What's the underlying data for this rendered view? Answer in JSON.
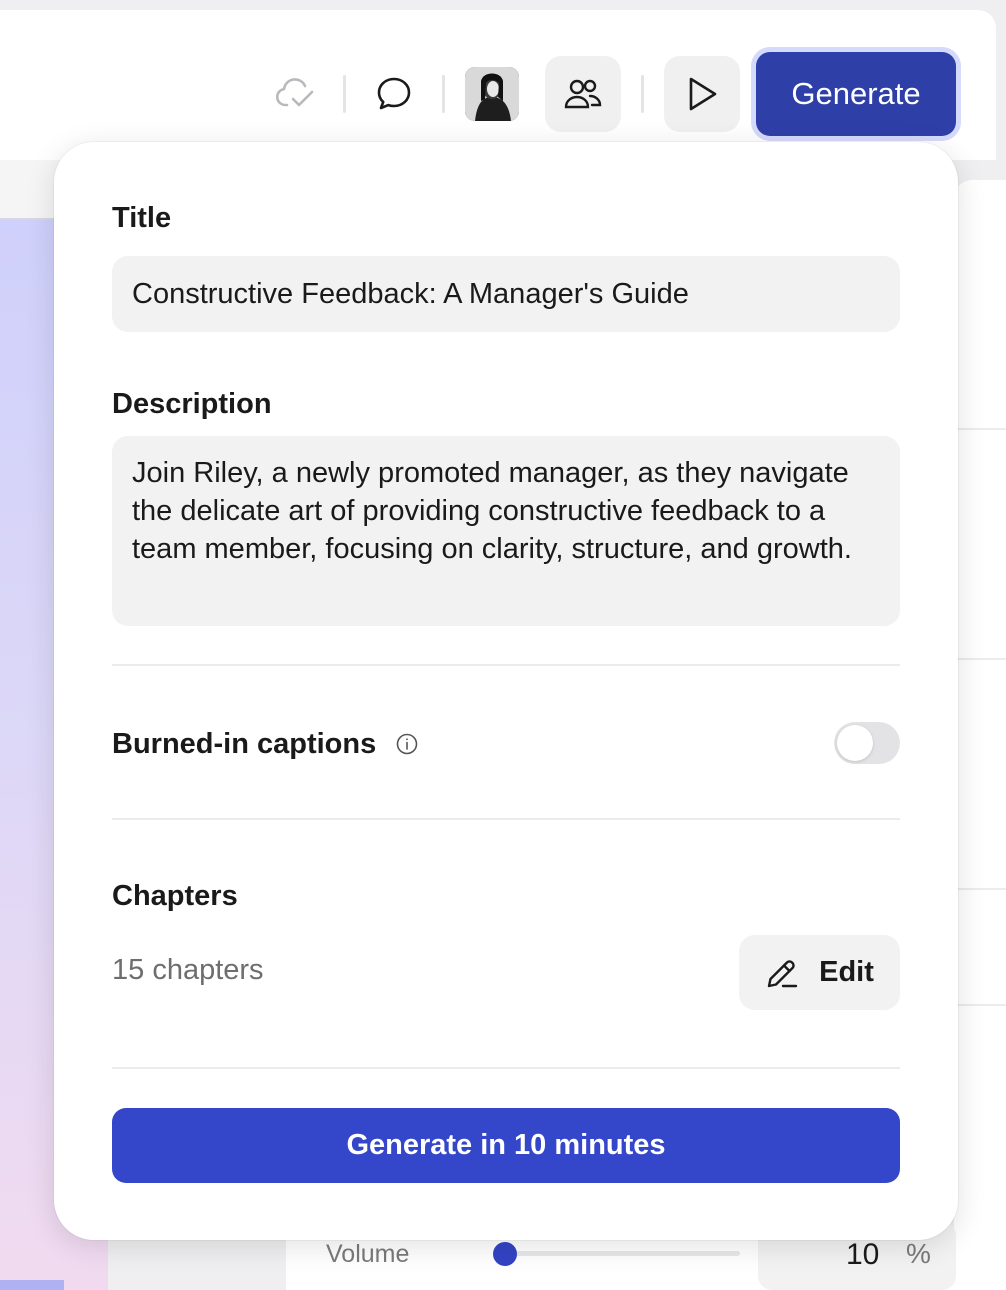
{
  "toolbar": {
    "generate_label": "Generate"
  },
  "panel": {
    "title_label": "Title",
    "title_value": "Constructive Feedback: A Manager's Guide",
    "description_label": "Description",
    "description_value": "Join Riley, a newly promoted manager, as they navigate the delicate art of providing constructive feedback to a team member, focusing on clarity, structure, and growth.",
    "captions_label": "Burned-in captions",
    "captions_enabled": false,
    "chapters_label": "Chapters",
    "chapters_count": "15 chapters",
    "edit_label": "Edit",
    "primary_button_label": "Generate in 10 minutes"
  },
  "background": {
    "volume_label": "Volume",
    "volume_value": "10",
    "volume_unit": "%",
    "volume_level": 0.05
  },
  "colors": {
    "accent": "#3446c9",
    "toolbar_generate": "#2f3fa8"
  }
}
